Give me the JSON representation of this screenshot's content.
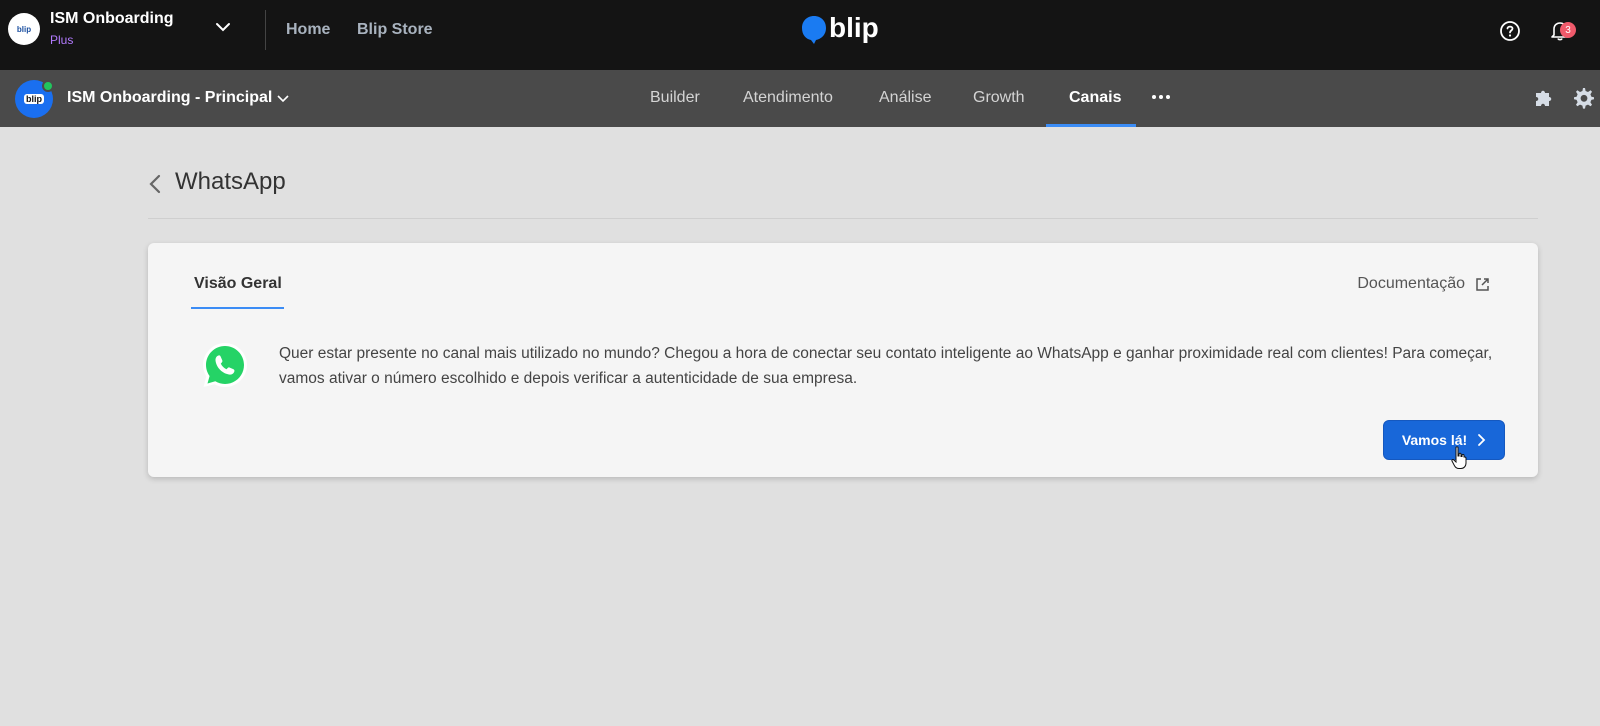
{
  "topbar": {
    "org_name": "ISM Onboarding",
    "org_plan": "Plus",
    "logo_text": "blip",
    "links": [
      "Home",
      "Blip Store"
    ],
    "brand": "blip",
    "notification_count": "3"
  },
  "secbar": {
    "bot_name": "ISM Onboarding - Principal",
    "avatar_text": "blip",
    "tabs": [
      "Builder",
      "Atendimento",
      "Análise",
      "Growth",
      "Canais"
    ],
    "active_tab": "Canais"
  },
  "page": {
    "title": "WhatsApp"
  },
  "card": {
    "tab_label": "Visão Geral",
    "doc_link": "Documentação",
    "description": "Quer estar presente no canal mais utilizado no mundo? Chegou a hora de conectar seu contato inteligente ao WhatsApp e ganhar proximidade real com clientes! Para começar, vamos ativar o número escolhido e depois verificar a autenticidade de sua empresa.",
    "cta_label": "Vamos lá!"
  },
  "colors": {
    "primary": "#1867d9",
    "accent_underline": "#3b8cf5",
    "plan_purple": "#b37bff",
    "whatsapp_green": "#25d366",
    "badge_red": "#f05a6b"
  },
  "icons": [
    "chevron-down-icon",
    "help-icon",
    "bell-icon",
    "more-icon",
    "puzzle-icon",
    "gear-icon",
    "back-arrow-icon",
    "external-link-icon",
    "whatsapp-icon",
    "chevron-right-icon",
    "hand-cursor-icon"
  ]
}
